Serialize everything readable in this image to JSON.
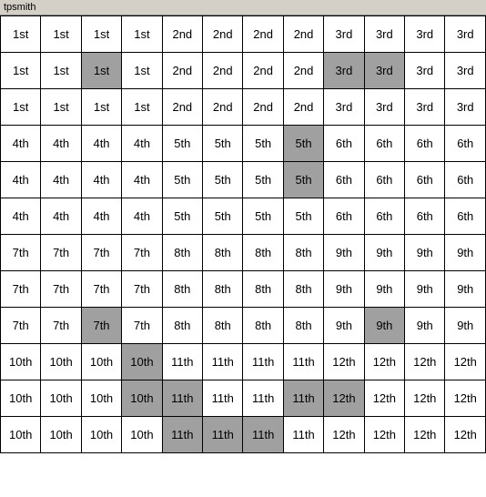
{
  "title": "tpsmith",
  "grid": {
    "rows": [
      [
        {
          "text": "1st",
          "highlight": false
        },
        {
          "text": "1st",
          "highlight": false
        },
        {
          "text": "1st",
          "highlight": false
        },
        {
          "text": "1st",
          "highlight": false
        },
        {
          "text": "2nd",
          "highlight": false
        },
        {
          "text": "2nd",
          "highlight": false
        },
        {
          "text": "2nd",
          "highlight": false
        },
        {
          "text": "2nd",
          "highlight": false
        },
        {
          "text": "3rd",
          "highlight": false
        },
        {
          "text": "3rd",
          "highlight": false
        },
        {
          "text": "3rd",
          "highlight": false
        },
        {
          "text": "3rd",
          "highlight": false
        }
      ],
      [
        {
          "text": "1st",
          "highlight": false
        },
        {
          "text": "1st",
          "highlight": false
        },
        {
          "text": "1st",
          "highlight": true
        },
        {
          "text": "1st",
          "highlight": false
        },
        {
          "text": "2nd",
          "highlight": false
        },
        {
          "text": "2nd",
          "highlight": false
        },
        {
          "text": "2nd",
          "highlight": false
        },
        {
          "text": "2nd",
          "highlight": false
        },
        {
          "text": "3rd",
          "highlight": true
        },
        {
          "text": "3rd",
          "highlight": true
        },
        {
          "text": "3rd",
          "highlight": false
        },
        {
          "text": "3rd",
          "highlight": false
        }
      ],
      [
        {
          "text": "1st",
          "highlight": false
        },
        {
          "text": "1st",
          "highlight": false
        },
        {
          "text": "1st",
          "highlight": false
        },
        {
          "text": "1st",
          "highlight": false
        },
        {
          "text": "2nd",
          "highlight": false
        },
        {
          "text": "2nd",
          "highlight": false
        },
        {
          "text": "2nd",
          "highlight": false
        },
        {
          "text": "2nd",
          "highlight": false
        },
        {
          "text": "3rd",
          "highlight": false
        },
        {
          "text": "3rd",
          "highlight": false
        },
        {
          "text": "3rd",
          "highlight": false
        },
        {
          "text": "3rd",
          "highlight": false
        }
      ],
      [
        {
          "text": "4th",
          "highlight": false
        },
        {
          "text": "4th",
          "highlight": false
        },
        {
          "text": "4th",
          "highlight": false
        },
        {
          "text": "4th",
          "highlight": false
        },
        {
          "text": "5th",
          "highlight": false
        },
        {
          "text": "5th",
          "highlight": false
        },
        {
          "text": "5th",
          "highlight": false
        },
        {
          "text": "5th",
          "highlight": true
        },
        {
          "text": "6th",
          "highlight": false
        },
        {
          "text": "6th",
          "highlight": false
        },
        {
          "text": "6th",
          "highlight": false
        },
        {
          "text": "6th",
          "highlight": false
        }
      ],
      [
        {
          "text": "4th",
          "highlight": false
        },
        {
          "text": "4th",
          "highlight": false
        },
        {
          "text": "4th",
          "highlight": false
        },
        {
          "text": "4th",
          "highlight": false
        },
        {
          "text": "5th",
          "highlight": false
        },
        {
          "text": "5th",
          "highlight": false
        },
        {
          "text": "5th",
          "highlight": false
        },
        {
          "text": "5th",
          "highlight": true
        },
        {
          "text": "6th",
          "highlight": false
        },
        {
          "text": "6th",
          "highlight": false
        },
        {
          "text": "6th",
          "highlight": false
        },
        {
          "text": "6th",
          "highlight": false
        }
      ],
      [
        {
          "text": "4th",
          "highlight": false
        },
        {
          "text": "4th",
          "highlight": false
        },
        {
          "text": "4th",
          "highlight": false
        },
        {
          "text": "4th",
          "highlight": false
        },
        {
          "text": "5th",
          "highlight": false
        },
        {
          "text": "5th",
          "highlight": false
        },
        {
          "text": "5th",
          "highlight": false
        },
        {
          "text": "5th",
          "highlight": false
        },
        {
          "text": "6th",
          "highlight": false
        },
        {
          "text": "6th",
          "highlight": false
        },
        {
          "text": "6th",
          "highlight": false
        },
        {
          "text": "6th",
          "highlight": false
        }
      ],
      [
        {
          "text": "7th",
          "highlight": false
        },
        {
          "text": "7th",
          "highlight": false
        },
        {
          "text": "7th",
          "highlight": false
        },
        {
          "text": "7th",
          "highlight": false
        },
        {
          "text": "8th",
          "highlight": false
        },
        {
          "text": "8th",
          "highlight": false
        },
        {
          "text": "8th",
          "highlight": false
        },
        {
          "text": "8th",
          "highlight": false
        },
        {
          "text": "9th",
          "highlight": false
        },
        {
          "text": "9th",
          "highlight": false
        },
        {
          "text": "9th",
          "highlight": false
        },
        {
          "text": "9th",
          "highlight": false
        }
      ],
      [
        {
          "text": "7th",
          "highlight": false
        },
        {
          "text": "7th",
          "highlight": false
        },
        {
          "text": "7th",
          "highlight": false
        },
        {
          "text": "7th",
          "highlight": false
        },
        {
          "text": "8th",
          "highlight": false
        },
        {
          "text": "8th",
          "highlight": false
        },
        {
          "text": "8th",
          "highlight": false
        },
        {
          "text": "8th",
          "highlight": false
        },
        {
          "text": "9th",
          "highlight": false
        },
        {
          "text": "9th",
          "highlight": false
        },
        {
          "text": "9th",
          "highlight": false
        },
        {
          "text": "9th",
          "highlight": false
        }
      ],
      [
        {
          "text": "7th",
          "highlight": false
        },
        {
          "text": "7th",
          "highlight": false
        },
        {
          "text": "7th",
          "highlight": true
        },
        {
          "text": "7th",
          "highlight": false
        },
        {
          "text": "8th",
          "highlight": false
        },
        {
          "text": "8th",
          "highlight": false
        },
        {
          "text": "8th",
          "highlight": false
        },
        {
          "text": "8th",
          "highlight": false
        },
        {
          "text": "9th",
          "highlight": false
        },
        {
          "text": "9th",
          "highlight": true
        },
        {
          "text": "9th",
          "highlight": false
        },
        {
          "text": "9th",
          "highlight": false
        }
      ],
      [
        {
          "text": "10th",
          "highlight": false
        },
        {
          "text": "10th",
          "highlight": false
        },
        {
          "text": "10th",
          "highlight": false
        },
        {
          "text": "10th",
          "highlight": true
        },
        {
          "text": "11th",
          "highlight": false
        },
        {
          "text": "11th",
          "highlight": false
        },
        {
          "text": "11th",
          "highlight": false
        },
        {
          "text": "11th",
          "highlight": false
        },
        {
          "text": "12th",
          "highlight": false
        },
        {
          "text": "12th",
          "highlight": false
        },
        {
          "text": "12th",
          "highlight": false
        },
        {
          "text": "12th",
          "highlight": false
        }
      ],
      [
        {
          "text": "10th",
          "highlight": false
        },
        {
          "text": "10th",
          "highlight": false
        },
        {
          "text": "10th",
          "highlight": false
        },
        {
          "text": "10th",
          "highlight": true
        },
        {
          "text": "11th",
          "highlight": true
        },
        {
          "text": "11th",
          "highlight": false
        },
        {
          "text": "11th",
          "highlight": false
        },
        {
          "text": "11th",
          "highlight": true
        },
        {
          "text": "12th",
          "highlight": true
        },
        {
          "text": "12th",
          "highlight": false
        },
        {
          "text": "12th",
          "highlight": false
        },
        {
          "text": "12th",
          "highlight": false
        }
      ],
      [
        {
          "text": "10th",
          "highlight": false
        },
        {
          "text": "10th",
          "highlight": false
        },
        {
          "text": "10th",
          "highlight": false
        },
        {
          "text": "10th",
          "highlight": false
        },
        {
          "text": "11th",
          "highlight": true
        },
        {
          "text": "11th",
          "highlight": true
        },
        {
          "text": "11th",
          "highlight": true
        },
        {
          "text": "11th",
          "highlight": false
        },
        {
          "text": "12th",
          "highlight": false
        },
        {
          "text": "12th",
          "highlight": false
        },
        {
          "text": "12th",
          "highlight": false
        },
        {
          "text": "12th",
          "highlight": false
        }
      ]
    ]
  }
}
